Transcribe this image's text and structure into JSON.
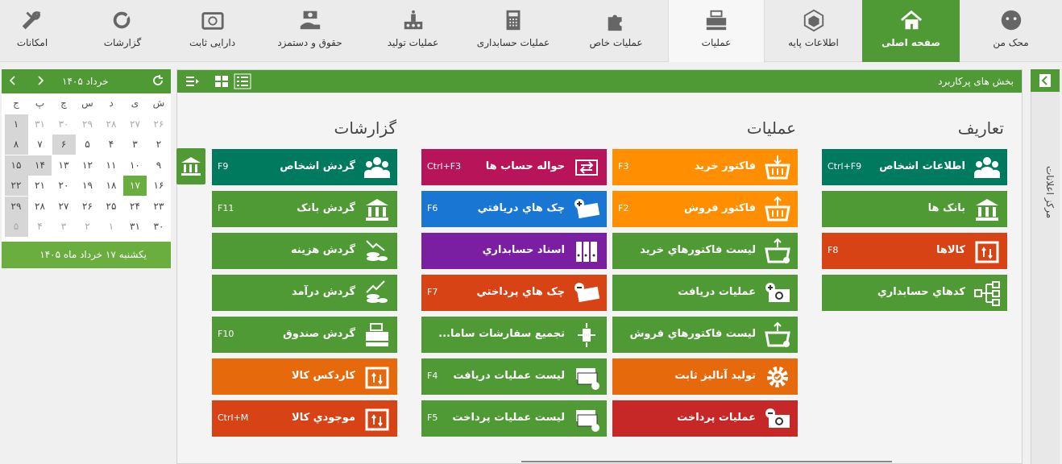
{
  "topnav": [
    {
      "label": "امکانات",
      "icon": "tools-icon"
    },
    {
      "label": "گزارشات",
      "icon": "chart-icon"
    },
    {
      "label": "دارایی ثابت",
      "icon": "safe-icon"
    },
    {
      "label": "حقوق و دستمزد",
      "icon": "payroll-icon"
    },
    {
      "label": "عملیات تولید",
      "icon": "factory-icon"
    },
    {
      "label": "عملیات حسابداری",
      "icon": "calculator-icon"
    },
    {
      "label": "عملیات خاص",
      "icon": "puzzle-icon"
    },
    {
      "label": "عملیات",
      "icon": "cash-register-icon"
    },
    {
      "label": "اطلاعات پایه",
      "icon": "cube-icon"
    },
    {
      "label": "صفحه اصلی",
      "icon": "home-icon"
    },
    {
      "label": "محک من",
      "icon": "avatar-icon"
    }
  ],
  "panel": {
    "title": "بخش های پرکاربرد"
  },
  "sidebar": {
    "label": "مرکز اعلانات"
  },
  "sections": {
    "definitions": "تعاریف",
    "operations": "عملیات",
    "reports": "گزارشات"
  },
  "colors": {
    "brand": "#4f9a34",
    "teal": "#007a5e",
    "orange": "#ff8f00",
    "darkorange": "#e66a0c",
    "red": "#d84315",
    "crimson": "#c62828",
    "magenta": "#b7145a",
    "blue": "#1976d2",
    "purple": "#7b1fa2"
  },
  "tiles": {
    "definitions": [
      {
        "label": "اطلاعات اشخاص",
        "key": "Ctrl+F9",
        "icon": "people-icon",
        "color": "#007a5e"
      },
      {
        "label": "بانک ها",
        "key": "",
        "icon": "bank-icon",
        "color": "#4f9a34"
      },
      {
        "label": "کالاها",
        "key": "F8",
        "icon": "goods-icon",
        "color": "#d84315"
      },
      {
        "label": "کدهاي حسابداري",
        "key": "",
        "icon": "hierarchy-icon",
        "color": "#4f9a34"
      }
    ],
    "operations1": [
      {
        "label": "فاکتور خرید",
        "key": "F3",
        "icon": "basket-down-icon",
        "color": "#ff8f00"
      },
      {
        "label": "فاکتور فروش",
        "key": "F2",
        "icon": "basket-up-icon",
        "color": "#ff8f00"
      },
      {
        "label": "لیست فاکتورهاي خرید",
        "key": "",
        "icon": "basket-list-icon",
        "color": "#4f9a34"
      },
      {
        "label": "عملیات دریافت",
        "key": "",
        "icon": "cash-in-icon",
        "color": "#4f9a34"
      },
      {
        "label": "لیست فاکتورهاي فروش",
        "key": "",
        "icon": "basket-list-icon",
        "color": "#4f9a34"
      },
      {
        "label": "تولید آنالیز ثابت",
        "key": "",
        "icon": "gear-icon",
        "color": "#e66a0c"
      },
      {
        "label": "عملیات پرداخت",
        "key": "",
        "icon": "cash-out-icon",
        "color": "#c62828"
      }
    ],
    "operations2": [
      {
        "label": "حواله حساب ها",
        "key": "Ctrl+F3",
        "icon": "transfer-icon",
        "color": "#b7145a"
      },
      {
        "label": "چک هاي دریافتي",
        "key": "F6",
        "icon": "cheque-in-icon",
        "color": "#1976d2"
      },
      {
        "label": "اسناد حسابداري",
        "key": "",
        "icon": "binders-icon",
        "color": "#7b1fa2"
      },
      {
        "label": "چک هاي پرداختي",
        "key": "F7",
        "icon": "cheque-out-icon",
        "color": "#d84315"
      },
      {
        "label": "تجمیع سفارشات ساما...",
        "key": "",
        "icon": "merge-icon",
        "color": "#4f9a34"
      },
      {
        "label": "لیست عملیات دریافت",
        "key": "F4",
        "icon": "cash-list-icon",
        "color": "#4f9a34"
      },
      {
        "label": "لیست عملیات پرداخت",
        "key": "F5",
        "icon": "cash-list-icon",
        "color": "#4f9a34"
      }
    ],
    "reports": [
      {
        "label": "گردش اشخاص",
        "key": "F9",
        "icon": "people-icon",
        "color": "#007a5e"
      },
      {
        "label": "گردش بانک",
        "key": "F11",
        "icon": "bank-icon",
        "color": "#4f9a34"
      },
      {
        "label": "گردش هزینه",
        "key": "",
        "icon": "coins-down-icon",
        "color": "#4f9a34"
      },
      {
        "label": "گردش درآمد",
        "key": "",
        "icon": "coins-up-icon",
        "color": "#4f9a34"
      },
      {
        "label": "گردش صندوق",
        "key": "F10",
        "icon": "register-icon",
        "color": "#4f9a34"
      },
      {
        "label": "کاردکس کالا",
        "key": "",
        "icon": "goods-icon",
        "color": "#e66a0c"
      },
      {
        "label": "موجودي کالا",
        "key": "Ctrl+M",
        "icon": "goods-icon",
        "color": "#d84315"
      }
    ]
  },
  "calendar": {
    "title": "خرداد ۱۴۰۵",
    "dow": [
      "ش",
      "ی",
      "د",
      "س",
      "چ",
      "پ",
      "ج"
    ],
    "rows": [
      [
        "۲۶",
        "۲۷",
        "۲۸",
        "۲۹",
        "۳۰",
        "۳۱",
        "۱"
      ],
      [
        "۲",
        "۳",
        "۴",
        "۵",
        "۶",
        "۷",
        "۸"
      ],
      [
        "۹",
        "۱۰",
        "۱۱",
        "۱۲",
        "۱۳",
        "۱۴",
        "۱۵"
      ],
      [
        "۱۶",
        "۱۷",
        "۱۸",
        "۱۹",
        "۲۰",
        "۲۱",
        "۲۲"
      ],
      [
        "۲۳",
        "۲۴",
        "۲۵",
        "۲۶",
        "۲۷",
        "۲۸",
        "۲۹"
      ],
      [
        "۳۰",
        "۳۱",
        "۱",
        "۲",
        "۳",
        "۴",
        "۵"
      ]
    ],
    "footer": "یکشنبه ۱۷ خرداد ماه ۱۴۰۵"
  }
}
